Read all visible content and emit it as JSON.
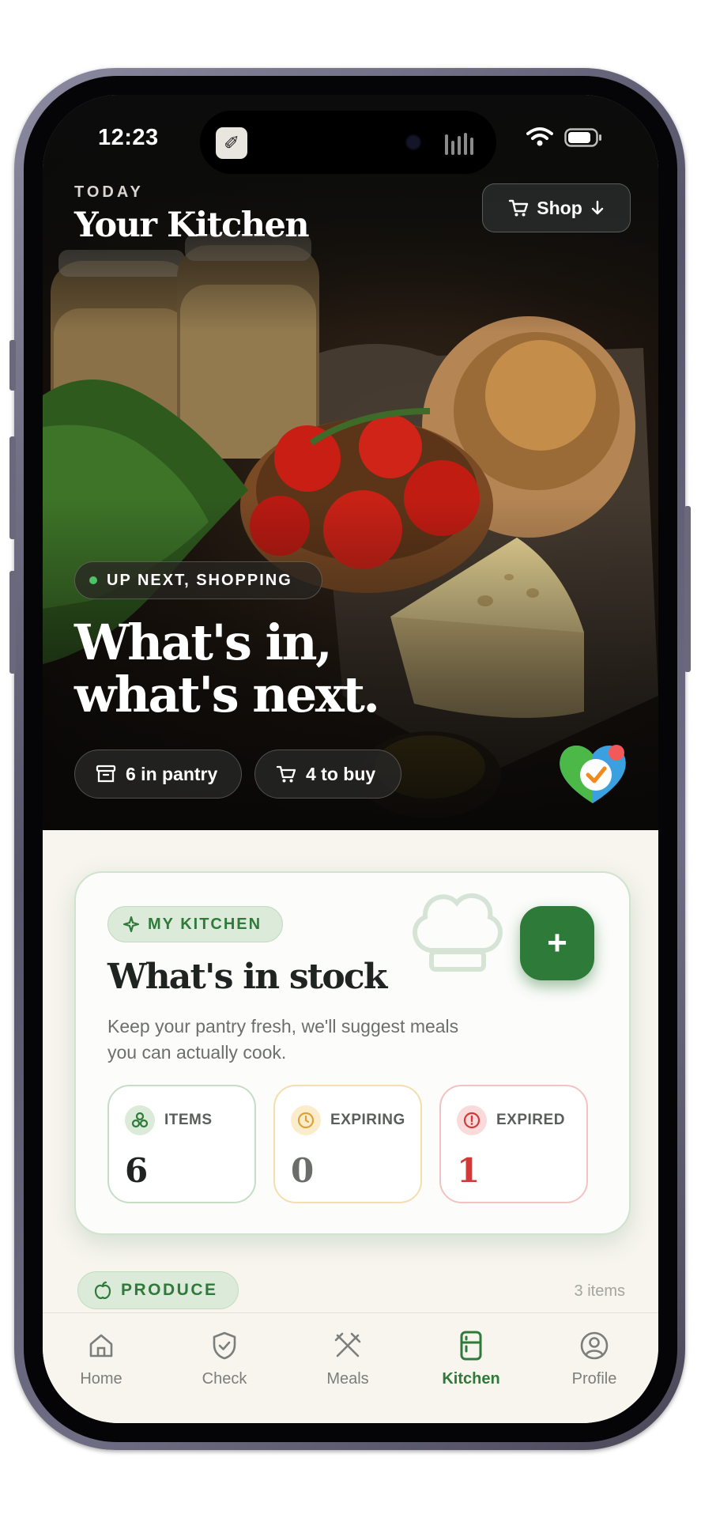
{
  "status_bar": {
    "time": "12:23",
    "island_app_icon": "wrench-app-icon"
  },
  "hero": {
    "eyebrow": "TODAY",
    "title": "Your Kitchen",
    "shop_button": "Shop",
    "next_pill": "UP NEXT, SHOPPING",
    "headline_line1": "What's in,",
    "headline_line2": "what's next.",
    "pantry_pill": "6 in pantry",
    "buy_pill": "4 to buy"
  },
  "card": {
    "tag": "MY KITCHEN",
    "title": "What's in stock",
    "subtitle": "Keep your pantry fresh, we'll suggest meals you can actually cook.",
    "add_button": "+",
    "metrics": [
      {
        "label": "ITEMS",
        "value": "6",
        "color": "#2e7a38"
      },
      {
        "label": "EXPIRING",
        "value": "0",
        "color": "#d9a33a"
      },
      {
        "label": "EXPIRED",
        "value": "1",
        "color": "#d23a3a"
      }
    ]
  },
  "section": {
    "tag": "PRODUCE",
    "count": "3 items"
  },
  "tabs": [
    {
      "label": "Home",
      "icon": "home-icon",
      "active": false
    },
    {
      "label": "Check",
      "icon": "shield-check-icon",
      "active": false
    },
    {
      "label": "Meals",
      "icon": "utensils-icon",
      "active": false
    },
    {
      "label": "Kitchen",
      "icon": "fridge-icon",
      "active": true
    },
    {
      "label": "Profile",
      "icon": "user-circle-icon",
      "active": false
    }
  ],
  "colors": {
    "accent": "#2e7a38",
    "background": "#f7f5ee",
    "warning": "#d9a33a",
    "danger": "#d23a3a"
  }
}
